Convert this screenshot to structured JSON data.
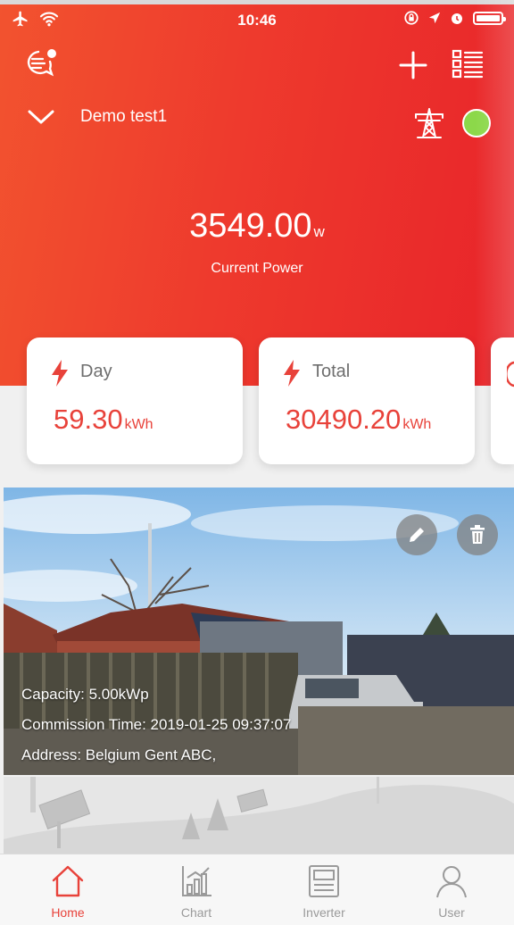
{
  "status": {
    "time": "10:46"
  },
  "site": {
    "name": "Demo test1",
    "status_color": "#8cd84a"
  },
  "power": {
    "value": "3549.00",
    "unit": "w",
    "label": "Current Power"
  },
  "cards": [
    {
      "label": "Day",
      "value": "59.30",
      "unit": "kWh"
    },
    {
      "label": "Total",
      "value": "30490.20",
      "unit": "kWh"
    }
  ],
  "plant": {
    "capacity": "Capacity: 5.00kWp",
    "commission_time": "Commission Time: 2019-01-25 09:37:07",
    "address": "Address: Belgium Gent ABC,"
  },
  "tabs": [
    {
      "label": "Home",
      "icon": "home-icon"
    },
    {
      "label": "Chart",
      "icon": "chart-icon"
    },
    {
      "label": "Inverter",
      "icon": "inverter-icon"
    },
    {
      "label": "User",
      "icon": "user-icon"
    }
  ],
  "colors": {
    "accent": "#e8423a",
    "header_start": "#f2532f",
    "header_end": "#e8242a",
    "tab_inactive": "#9a9a9a"
  }
}
